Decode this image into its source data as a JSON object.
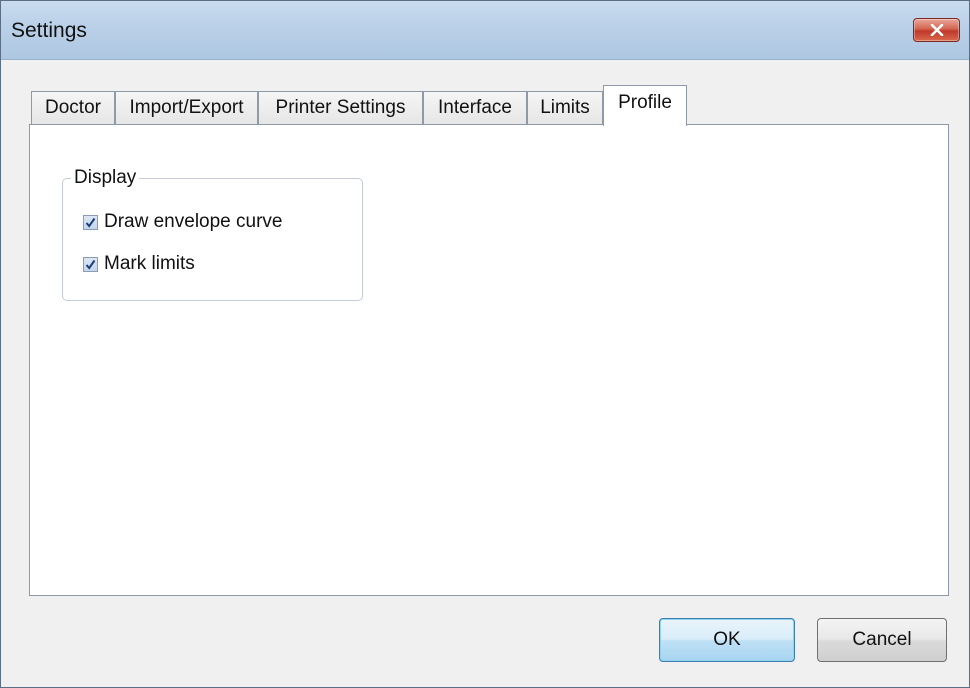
{
  "window": {
    "title": "Settings"
  },
  "tabs": [
    {
      "label": "Doctor",
      "selected": false
    },
    {
      "label": "Import/Export",
      "selected": false
    },
    {
      "label": "Printer Settings",
      "selected": false
    },
    {
      "label": "Interface",
      "selected": false
    },
    {
      "label": "Limits",
      "selected": false
    },
    {
      "label": "Profile",
      "selected": true
    }
  ],
  "display_group": {
    "label": "Display",
    "options": [
      {
        "label": "Draw envelope curve",
        "checked": true
      },
      {
        "label": "Mark limits",
        "checked": true
      }
    ]
  },
  "buttons": {
    "ok_label": "OK",
    "cancel_label": "Cancel"
  },
  "colors": {
    "titlebar": "#bad0e8",
    "close_button": "#c7432f",
    "default_button_border": "#3c7fb1"
  }
}
